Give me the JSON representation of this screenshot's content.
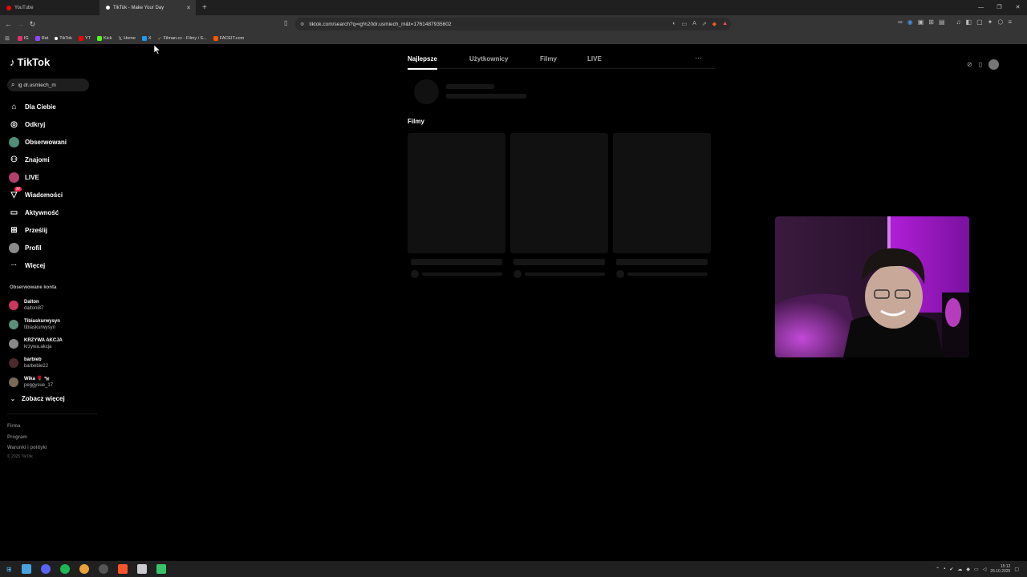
{
  "browser": {
    "tabs": [
      {
        "label": "YouTube",
        "active": false,
        "fav_color": "#ff0000"
      },
      {
        "label": "TikTok - Make Your Day",
        "active": true,
        "fav_color": "#ffffff"
      }
    ],
    "new_tab_glyph": "+",
    "url": "tiktok.com/search?q=ig%20dr.usmiech_m&t=1761487935602",
    "bookmarks": [
      {
        "label": "IG",
        "color": "#e1306c"
      },
      {
        "label": "Rat",
        "color": "#9146ff"
      },
      {
        "label": "TikTok",
        "color": "#ffffff"
      },
      {
        "label": "YT",
        "color": "#ff0000"
      },
      {
        "label": "Kick",
        "color": "#53fc18"
      },
      {
        "label": "Home",
        "color": "#ffffff"
      },
      {
        "label": "X",
        "color": "#1d9bf0"
      },
      {
        "label": "Filman.cc - Filmy i S...",
        "color": "#d4a73b"
      },
      {
        "label": "FACEIT.com",
        "color": "#ff5500"
      }
    ]
  },
  "tiktok": {
    "logo_text": "TikTok",
    "search_value": "ig dr.usmiech_m",
    "nav": [
      {
        "label": "Dla Ciebie",
        "icon": "home-icon"
      },
      {
        "label": "Odkryj",
        "icon": "compass-icon"
      },
      {
        "label": "Obserwowani",
        "icon": "following-avatar-icon"
      },
      {
        "label": "Znajomi",
        "icon": "friends-icon"
      },
      {
        "label": "LIVE",
        "icon": "live-icon"
      },
      {
        "label": "Wiadomości",
        "icon": "messages-icon",
        "badge": "77"
      },
      {
        "label": "Aktywność",
        "icon": "activity-icon"
      },
      {
        "label": "Prześlij",
        "icon": "upload-icon"
      },
      {
        "label": "Profil",
        "icon": "profile-icon"
      },
      {
        "label": "Więcej",
        "icon": "more-icon"
      }
    ],
    "followed_label": "Obserwowane konta",
    "followed": [
      {
        "name": "Dalton",
        "handle": "daltoni87",
        "color": "#c9385e"
      },
      {
        "name": "Tibiaskurwysyn",
        "handle": "tibiaskurwysyn",
        "color": "#5a8f7b"
      },
      {
        "name": "KRZYWA AKCJA",
        "handle": "krzywa.akcja",
        "color": "#888888"
      },
      {
        "name": "barbieb",
        "handle": "barbebie22",
        "color": "#4a2a2a"
      },
      {
        "name": "Wika 🌹 🐄",
        "handle": "peggysue_17",
        "color": "#7a6a5a"
      }
    ],
    "see_more": "Zobacz więcej",
    "footer": [
      "Firma",
      "Program",
      "Warunki i polityki"
    ],
    "copyright": "© 2025 TikTok",
    "result_tabs": [
      "Najlepsze",
      "Użytkownicy",
      "Filmy",
      "LIVE"
    ],
    "more_glyph": "···",
    "section_title": "Filmy"
  },
  "taskbar": {
    "time": "15:12",
    "date": "26.10.2025"
  }
}
